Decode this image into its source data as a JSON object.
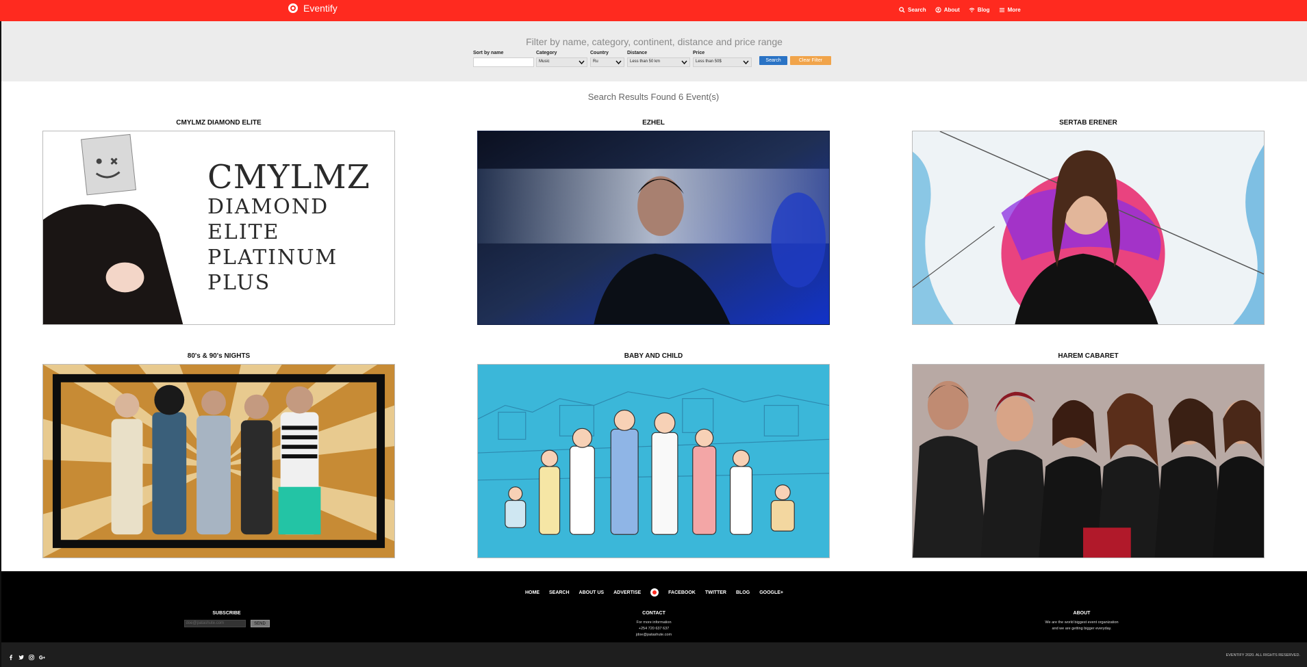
{
  "brand": {
    "name": "Eventify"
  },
  "nav": [
    {
      "label": "Search",
      "icon": "search-icon"
    },
    {
      "label": "About",
      "icon": "user-circle-icon"
    },
    {
      "label": "Blog",
      "icon": "wifi-icon"
    },
    {
      "label": "More",
      "icon": "menu-icon"
    }
  ],
  "filter": {
    "title": "Filter by name, category, continent, distance and price range",
    "fields": {
      "sort_label": "Sort by name",
      "sort_value": "",
      "category_label": "Category",
      "category_value": "Music",
      "country_label": "Country",
      "country_value": "Ru",
      "distance_label": "Distance",
      "distance_value": "Less than 50 km",
      "price_label": "Price",
      "price_value": "Less than 50$"
    },
    "search_btn": "Search",
    "clear_btn": "Clear Filter"
  },
  "results": {
    "title": "Search Results Found 6 Event(s)",
    "events": [
      {
        "title": "CMYLMZ DIAMOND ELITE",
        "poster_text": [
          "CMYLMZ",
          "DIAMOND",
          "ELITE",
          "PLATINUM",
          "PLUS"
        ]
      },
      {
        "title": "EZHEL"
      },
      {
        "title": "SERTAB ERENER"
      },
      {
        "title": "80's & 90's NIGHTS"
      },
      {
        "title": "BABY AND CHILD"
      },
      {
        "title": "HAREM CABARET"
      }
    ]
  },
  "footer": {
    "nav": [
      "HOME",
      "SEARCH",
      "ABOUT US",
      "ADVERTISE",
      "FACEBOOK",
      "TWITTER",
      "BLOG",
      "GOOGLE+"
    ],
    "subscribe": {
      "heading": "SUBSCRIBE",
      "placeholder": "doe@patashute.com",
      "button": "SEND"
    },
    "contact": {
      "heading": "CONTACT",
      "lines": [
        "For more information",
        "+254 720 637 637",
        "jdoe@patashute.com"
      ]
    },
    "about": {
      "heading": "ABOUT",
      "lines": [
        "We are the world biggest event organization",
        "and we are getting bigger everyday."
      ]
    },
    "copyright": "EVENTIFY 2020. ALL RIGHTS RESERVED.",
    "social": [
      "facebook-icon",
      "twitter-icon",
      "instagram-icon",
      "google-plus-icon"
    ]
  },
  "colors": {
    "primary": "#ff2a1f",
    "search_btn": "#2a73c5",
    "clear_btn": "#f1a44a",
    "footer_bg": "#000000"
  }
}
